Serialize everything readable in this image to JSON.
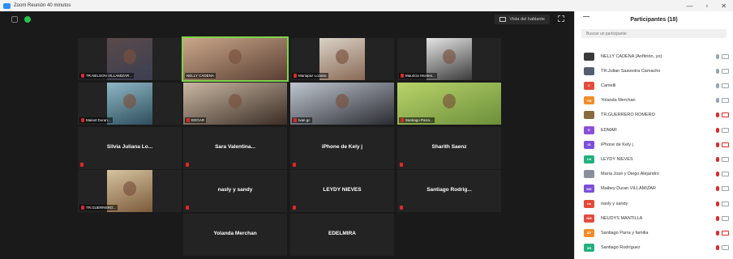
{
  "window": {
    "title": "Zoom Reunión 40 minutos"
  },
  "topbar": {
    "view_label": "Vista del hablante"
  },
  "tiles": [
    {
      "name": "",
      "label": "TR.NELSON VILLAMIZAR...",
      "video": "video-1",
      "mic_off": true
    },
    {
      "name": "",
      "label": "NELLY CADENA",
      "video": "video-2",
      "mic_off": false,
      "active": true
    },
    {
      "name": "",
      "label": "Mariapaz Lozano",
      "video": "video-3",
      "mic_off": true
    },
    {
      "name": "",
      "label": "Mauricio Montes...",
      "video": "video-4",
      "mic_off": true
    },
    {
      "name": "",
      "label": "Maiset Duran...",
      "video": "video-5",
      "mic_off": true
    },
    {
      "name": "",
      "label": "EDGAR",
      "video": "video-6",
      "mic_off": true
    },
    {
      "name": "",
      "label": "Ivan gc",
      "video": "video-7",
      "mic_off": true
    },
    {
      "name": "",
      "label": "Santiago Parra...",
      "video": "video-8",
      "mic_off": true
    },
    {
      "name": "Silvia Juliana Lo...",
      "mic_off": true
    },
    {
      "name": "Sara Valentina...",
      "mic_off": true
    },
    {
      "name": "iPhone de Kely j",
      "mic_off": true
    },
    {
      "name": "Sharith Saenz",
      "mic_off": true
    },
    {
      "name": "",
      "label": "TR.GUERRERO...",
      "video": "video-9",
      "mic_off": true
    },
    {
      "name": "nasly y sandy",
      "mic_off": true
    },
    {
      "name": "LEYDY NIEVES",
      "mic_off": true
    },
    {
      "name": "Santiago Rodrig...",
      "mic_off": true
    },
    {
      "name": "Yolanda Merchan",
      "mic_off": false
    },
    {
      "name": "EDELMIRA",
      "mic_off": false
    }
  ],
  "panel": {
    "title": "Participantes (18)",
    "search_placeholder": "Buscar un participante",
    "participants": [
      {
        "name": "NELLY CADENA (Anfitrión, yo)",
        "initials": "",
        "color": "#3a3a3a",
        "mic": "on",
        "cam": "on"
      },
      {
        "name": "TR.Julian Saavedra Camacho",
        "initials": "",
        "color": "#555e70",
        "mic": "on",
        "cam": "on"
      },
      {
        "name": "Camelli",
        "initials": "C",
        "color": "#e24b3b",
        "mic": "on",
        "cam": "on"
      },
      {
        "name": "Yolanda Merchan",
        "initials": "YM",
        "color": "#f28c28",
        "mic": "on",
        "cam": "on"
      },
      {
        "name": "TR.GUERRERO ROMERO",
        "initials": "",
        "color": "#8b6a3e",
        "mic": "off",
        "cam": "off"
      },
      {
        "name": "EDMAR",
        "initials": "E",
        "color": "#8a4fd8",
        "mic": "off",
        "cam": "on"
      },
      {
        "name": "iPhone de Kely j",
        "initials": "iD",
        "color": "#7b4fd8",
        "mic": "off",
        "cam": "off"
      },
      {
        "name": "LEYDY NIEVES",
        "initials": "LN",
        "color": "#22b07d",
        "mic": "off",
        "cam": "on"
      },
      {
        "name": "María José y Diego Alejandro",
        "initials": "",
        "color": "#8a8f99",
        "mic": "off",
        "cam": "on"
      },
      {
        "name": "Maibey Duran VILLAMIZAR",
        "initials": "MD",
        "color": "#7b4fd8",
        "mic": "off",
        "cam": "on"
      },
      {
        "name": "nasly y sandy",
        "initials": "ns",
        "color": "#e24b3b",
        "mic": "off",
        "cam": "on"
      },
      {
        "name": "NEUDYS MANTILLA",
        "initials": "NM",
        "color": "#e24b3b",
        "mic": "off",
        "cam": "on"
      },
      {
        "name": "Santiago Parra y familia",
        "initials": "SP",
        "color": "#f28c28",
        "mic": "off",
        "cam": "off"
      },
      {
        "name": "Santiago Rodríguez",
        "initials": "SR",
        "color": "#22b07d",
        "mic": "off",
        "cam": "on"
      }
    ]
  }
}
